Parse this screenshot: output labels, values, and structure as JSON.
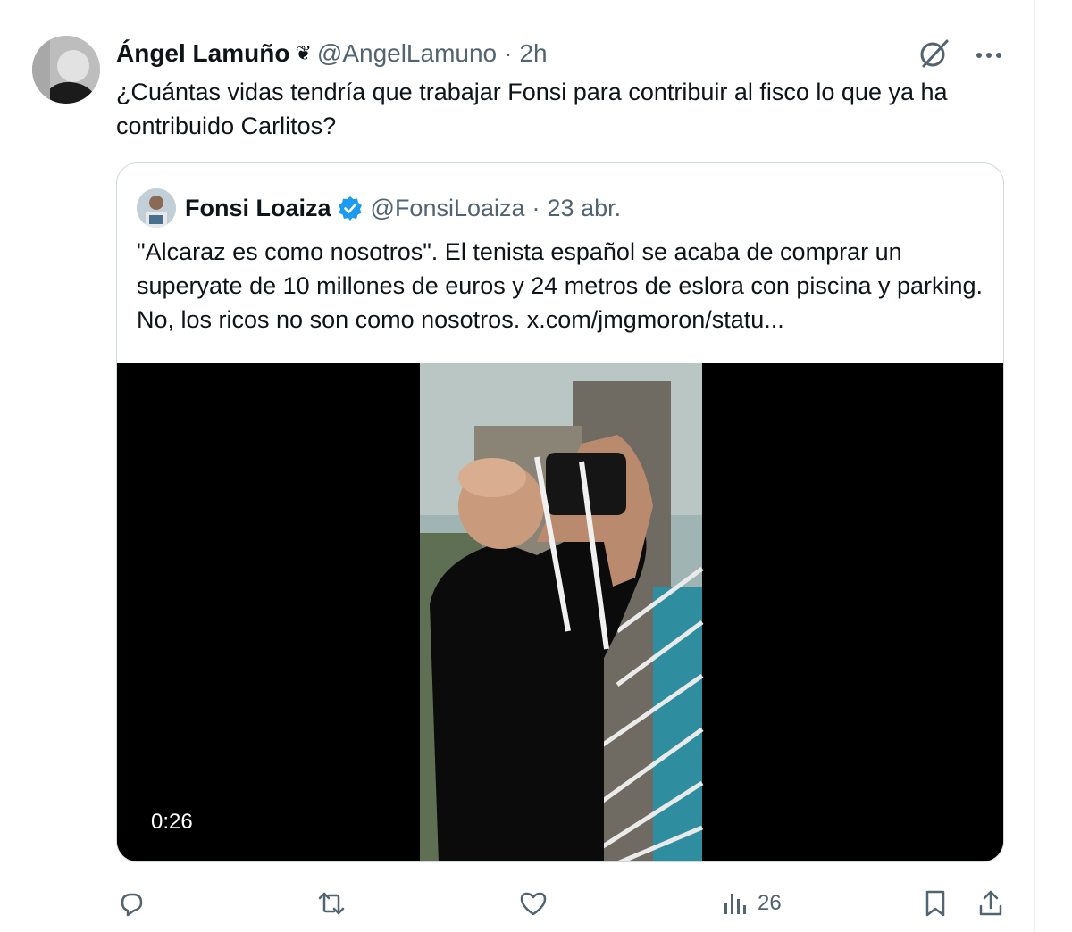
{
  "tweet": {
    "author_name": "Ángel Lamuño",
    "author_emoji": "❦",
    "author_handle": "@AngelLamuno",
    "separator": "·",
    "time": "2h",
    "text": "¿Cuántas vidas tendría que trabajar Fonsi para contribuir al fisco lo que ya ha contribuido Carlitos?"
  },
  "quoted": {
    "author_name": "Fonsi Loaiza",
    "author_handle": "@FonsiLoaiza",
    "separator": "·",
    "date": "23 abr.",
    "text": "\"Alcaraz es como nosotros\". El tenista español se acaba de comprar un superyate de 10 millones de euros y 24 metros de eslora con piscina y parking. No, los ricos no son como nosotros.  x.com/jmgmoron/statu...",
    "video_duration": "0:26"
  },
  "actions": {
    "views": "26"
  },
  "colors": {
    "text": "#0f1419",
    "secondary": "#536471",
    "border": "#cfd9de",
    "verified": "#1d9bf0"
  },
  "icons": [
    "grok-icon",
    "more-icon",
    "reply-icon",
    "retweet-icon",
    "like-icon",
    "views-icon",
    "bookmark-icon",
    "share-icon",
    "verified-badge-icon"
  ]
}
